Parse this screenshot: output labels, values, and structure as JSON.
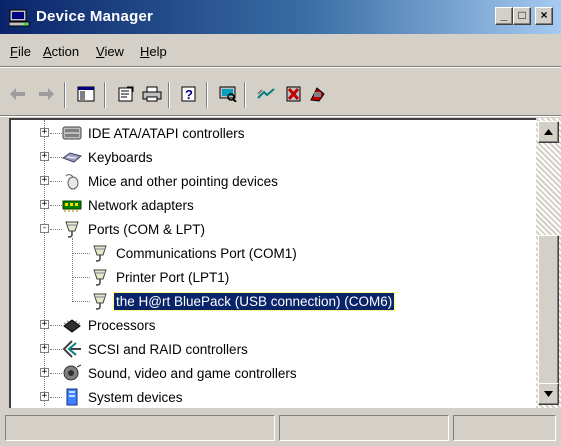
{
  "window": {
    "title": "Device Manager",
    "accent": "#0a246a",
    "controls": [
      "minimize-icon",
      "maximize-icon",
      "close-icon"
    ]
  },
  "menu": [
    {
      "label": "File",
      "accel": "F",
      "rest": "ile"
    },
    {
      "label": "Action",
      "accel": "A",
      "rest": "ction"
    },
    {
      "label": "View",
      "accel": "V",
      "rest": "iew"
    },
    {
      "label": "Help",
      "accel": "H",
      "rest": "elp"
    }
  ],
  "toolbar": {
    "buttons": [
      "back-arrow-icon",
      "forward-arrow-icon",
      "show-hide-console-tree-icon",
      "properties-icon",
      "print-icon",
      "help-icon",
      "scan-hardware-changes-icon",
      "update-driver-icon",
      "uninstall-icon",
      "disable-icon"
    ]
  },
  "tree": {
    "items": [
      {
        "label": "IDE ATA/ATAPI controllers",
        "icon": "ide-controller-icon",
        "level": 0,
        "expander": "+"
      },
      {
        "label": "Keyboards",
        "icon": "keyboard-icon",
        "level": 0,
        "expander": "+"
      },
      {
        "label": "Mice and other pointing devices",
        "icon": "mouse-icon",
        "level": 0,
        "expander": "+"
      },
      {
        "label": "Network adapters",
        "icon": "network-adapter-icon",
        "level": 0,
        "expander": "+"
      },
      {
        "label": "Ports (COM & LPT)",
        "icon": "port-connector-icon",
        "level": 0,
        "expander": "-"
      },
      {
        "label": "Communications Port (COM1)",
        "icon": "port-connector-icon",
        "level": 1
      },
      {
        "label": "Printer Port (LPT1)",
        "icon": "port-connector-icon",
        "level": 1
      },
      {
        "label": "the H@rt BluePack (USB connection) (COM6)",
        "icon": "port-connector-icon",
        "level": 1,
        "selected": true
      },
      {
        "label": "Processors",
        "icon": "processor-icon",
        "level": 0,
        "expander": "+"
      },
      {
        "label": "SCSI and RAID controllers",
        "icon": "scsi-controller-icon",
        "level": 0,
        "expander": "+"
      },
      {
        "label": "Sound, video and game controllers",
        "icon": "sound-icon",
        "level": 0,
        "expander": "+"
      },
      {
        "label": "System devices",
        "icon": "system-device-icon",
        "level": 0,
        "expander": "+"
      }
    ]
  },
  "statusbar": {
    "panes": [
      "",
      "",
      ""
    ]
  }
}
